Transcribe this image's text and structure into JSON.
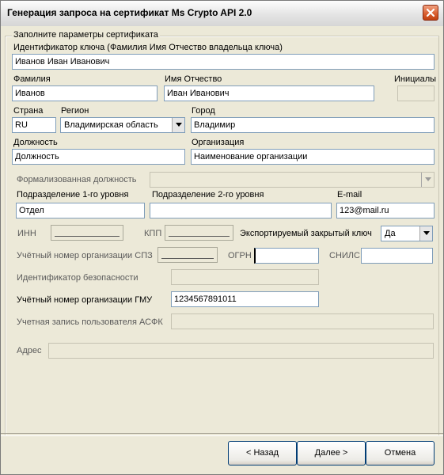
{
  "window": {
    "title": "Генерация запроса на сертификат Ms Crypto API 2.0"
  },
  "group": {
    "legend": "Заполните параметры сертификата"
  },
  "fields": {
    "key_id": {
      "label": "Идентификатор ключа (Фамилия Имя Отчество владельца ключа)",
      "value": "Иванов Иван Иванович"
    },
    "surname": {
      "label": "Фамилия",
      "value": "Иванов"
    },
    "name_patronymic": {
      "label": "Имя Отчество",
      "value": "Иван Иванович"
    },
    "initials": {
      "label": "Инициалы",
      "value": ""
    },
    "country": {
      "label": "Страна",
      "value": "RU"
    },
    "region": {
      "label": "Регион",
      "value": "Владимирская область"
    },
    "city": {
      "label": "Город",
      "value": "Владимир"
    },
    "position": {
      "label": "Должность",
      "value": "Должность"
    },
    "organization": {
      "label": "Организация",
      "value": "Наименование организации"
    },
    "formal_position": {
      "label": "Формализованная должность",
      "value": ""
    },
    "dept_level1": {
      "label": "Подразделение 1-го уровня",
      "value": "Отдел"
    },
    "dept_level2": {
      "label": "Подразделение 2-го уровня",
      "value": ""
    },
    "email": {
      "label": "E-mail",
      "value": "123@mail.ru"
    },
    "inn": {
      "label": "ИНН"
    },
    "kpp": {
      "label": "КПП"
    },
    "exportable_key": {
      "label": "Экспортируемый закрытый ключ",
      "value": "Да"
    },
    "spz_number": {
      "label": "Учётный номер организации СПЗ"
    },
    "ogrn": {
      "label": "ОГРН",
      "value": ""
    },
    "snils": {
      "label": "СНИЛС",
      "value": ""
    },
    "security_id": {
      "label": "Идентификатор безопасности",
      "value": ""
    },
    "gmu_number": {
      "label": "Учётный номер организации ГМУ",
      "value": "1234567891011"
    },
    "asfk_account": {
      "label": "Учетная запись пользователя АСФК",
      "value": ""
    },
    "address": {
      "label": "Адрес",
      "value": ""
    }
  },
  "buttons": {
    "back": "< Назад",
    "next": "Далее >",
    "cancel": "Отмена"
  }
}
